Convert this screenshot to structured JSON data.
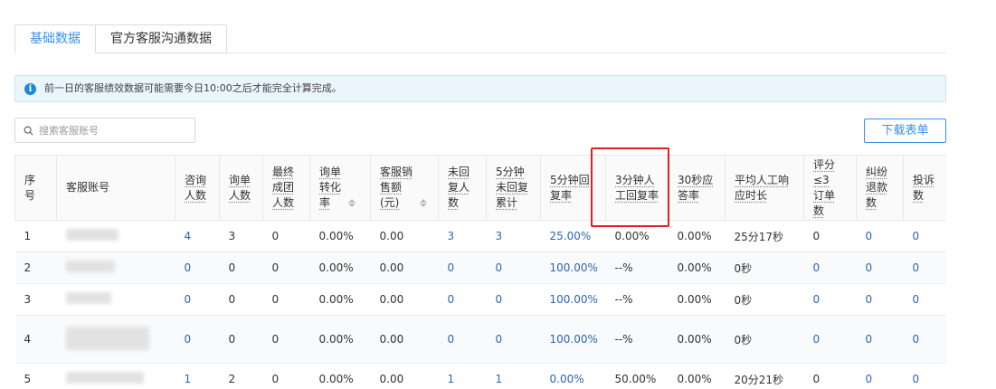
{
  "tabs": [
    {
      "label": "基础数据",
      "active": true
    },
    {
      "label": "官方客服沟通数据",
      "active": false
    }
  ],
  "notice": {
    "icon": "info-icon",
    "text": "前一日的客服绩效数据可能需要今日10:00之后才能完全计算完成。"
  },
  "search": {
    "placeholder": "搜索客服账号",
    "value": ""
  },
  "toolbar": {
    "download_label": "下载表单"
  },
  "colors": {
    "accent": "#3a8ee6",
    "link": "#2c66b8",
    "highlight": "#e02020",
    "notice_bg": "#eaf5fc"
  },
  "table": {
    "headers": [
      {
        "label": "序号"
      },
      {
        "label": "客服账号"
      },
      {
        "label": "咨询人数"
      },
      {
        "label": "询单人数"
      },
      {
        "label": "最终成团人数"
      },
      {
        "label": "询单转化率",
        "sortable": true
      },
      {
        "label": "客服销售额(元)",
        "sortable": true
      },
      {
        "label": "未回复人数"
      },
      {
        "label": "5分钟未回复累计"
      },
      {
        "label": "5分钟回复率"
      },
      {
        "label": "3分钟人工回复率",
        "highlighted": true
      },
      {
        "label": "30秒应答率"
      },
      {
        "label": "平均人工响应时长"
      },
      {
        "label": "评分≤3订单数"
      },
      {
        "label": "纠纷退款数"
      },
      {
        "label": "投诉数"
      }
    ],
    "rows": [
      {
        "index": "1",
        "consult": "4",
        "inquiry": "3",
        "group": "0",
        "conversion": "0.00%",
        "sales": "0.00",
        "no_reply": "3",
        "no_reply_5min": "3",
        "reply_5min": "25.00%",
        "reply_3min": "0.00%",
        "answer_30s": "0.00%",
        "avg_response": "25分17秒",
        "low_rating": "0",
        "dispute": "0",
        "complaint": "0"
      },
      {
        "index": "2",
        "consult": "0",
        "inquiry": "0",
        "group": "0",
        "conversion": "0.00%",
        "sales": "0.00",
        "no_reply": "0",
        "no_reply_5min": "0",
        "reply_5min": "100.00%",
        "reply_3min": "--%",
        "answer_30s": "0.00%",
        "avg_response": "0秒",
        "low_rating": "0",
        "dispute": "0",
        "complaint": "0"
      },
      {
        "index": "3",
        "consult": "0",
        "inquiry": "0",
        "group": "0",
        "conversion": "0.00%",
        "sales": "0.00",
        "no_reply": "0",
        "no_reply_5min": "0",
        "reply_5min": "100.00%",
        "reply_3min": "--%",
        "answer_30s": "0.00%",
        "avg_response": "0秒",
        "low_rating": "0",
        "dispute": "0",
        "complaint": "0"
      },
      {
        "index": "4",
        "consult": "0",
        "inquiry": "0",
        "group": "0",
        "conversion": "0.00%",
        "sales": "0.00",
        "no_reply": "0",
        "no_reply_5min": "0",
        "reply_5min": "100.00%",
        "reply_3min": "--%",
        "answer_30s": "0.00%",
        "avg_response": "0秒",
        "low_rating": "0",
        "dispute": "0",
        "complaint": "0"
      },
      {
        "index": "5",
        "consult": "1",
        "inquiry": "2",
        "group": "0",
        "conversion": "0.00%",
        "sales": "0.00",
        "no_reply": "1",
        "no_reply_5min": "1",
        "reply_5min": "0.00%",
        "reply_3min": "50.00%",
        "answer_30s": "0.00%",
        "avg_response": "20分21秒",
        "low_rating": "0",
        "dispute": "0",
        "complaint": "0"
      }
    ]
  }
}
